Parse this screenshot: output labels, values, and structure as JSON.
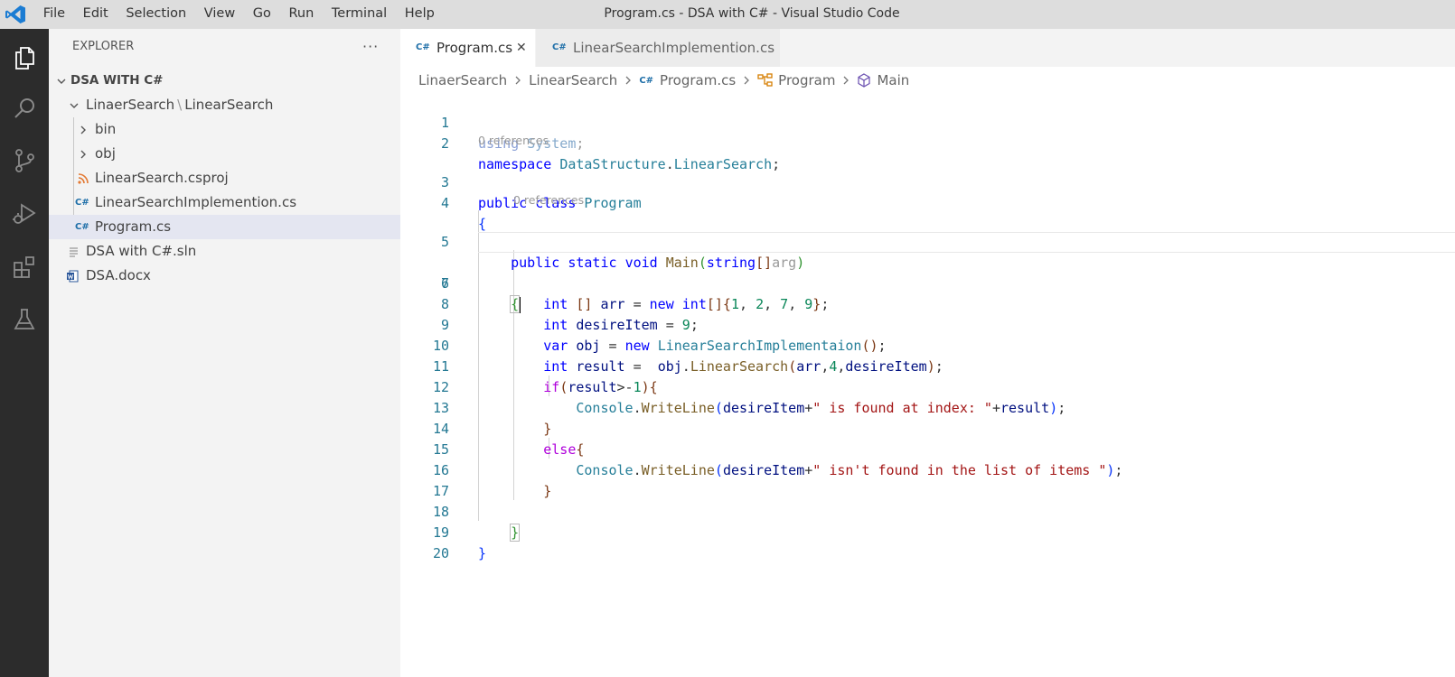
{
  "titlebar": {
    "menu": [
      "File",
      "Edit",
      "Selection",
      "View",
      "Go",
      "Run",
      "Terminal",
      "Help"
    ],
    "title": "Program.cs - DSA with C# - Visual Studio Code"
  },
  "activity_bar": {
    "items": [
      "explorer-icon",
      "search-icon",
      "source-control-icon",
      "run-debug-icon",
      "extensions-icon",
      "testing-icon"
    ]
  },
  "sidebar": {
    "title": "EXPLORER",
    "more": "···",
    "workspace": "DSA WITH C#",
    "folder_parent": "LinaerSearch",
    "folder_sep": "\\",
    "folder_child": "LinearSearch",
    "items": [
      {
        "label": "bin",
        "type": "folder"
      },
      {
        "label": "obj",
        "type": "folder"
      },
      {
        "label": "LinearSearch.csproj",
        "type": "rss"
      },
      {
        "label": "LinearSearchImplemention.cs",
        "type": "cs"
      },
      {
        "label": "Program.cs",
        "type": "cs",
        "selected": true
      },
      {
        "label": "DSA with C#.sln",
        "type": "sln"
      },
      {
        "label": "DSA.docx",
        "type": "word"
      }
    ]
  },
  "tabs": {
    "active": "Program.cs",
    "inactive": "LinearSearchImplemention.cs",
    "cs_glyph": "C#",
    "close": "✕"
  },
  "breadcrumb": {
    "parts": [
      "LinaerSearch",
      "LinearSearch",
      "Program.cs",
      "Program",
      "Main"
    ]
  },
  "editor": {
    "code_lens": "0 references",
    "line_numbers": [
      "1",
      "2",
      "3",
      "4",
      "5",
      "6",
      "7",
      "8",
      "9",
      "10",
      "11",
      "12",
      "13",
      "14",
      "15",
      "16",
      "17",
      "18",
      "19",
      "20"
    ]
  },
  "colors": {
    "keyword": "#0000ff",
    "control": "#af00db",
    "type": "#267f99",
    "function": "#795e26",
    "variable": "#001080",
    "number": "#098658",
    "string": "#a31515",
    "line_number": "#237893",
    "activity_bar": "#2c2c2c",
    "sidebar": "#f3f3f3",
    "selection": "#e4e6f1"
  }
}
